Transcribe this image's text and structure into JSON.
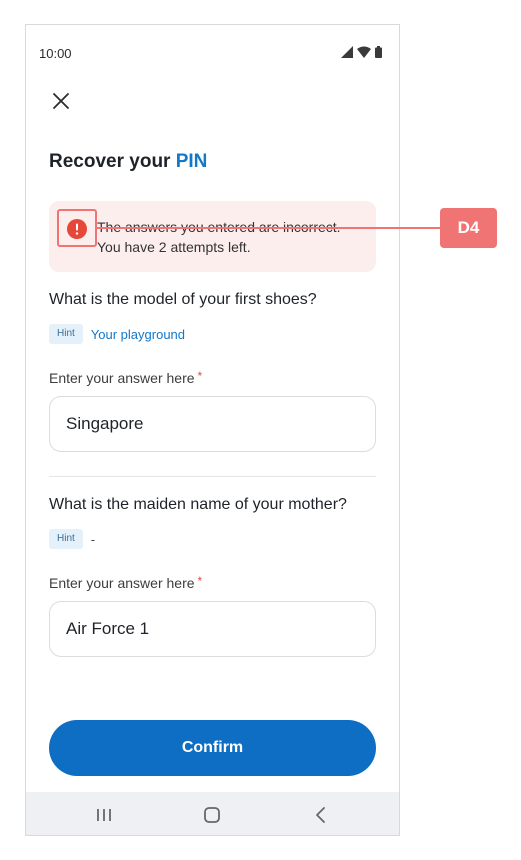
{
  "status_bar": {
    "time": "10:00"
  },
  "header": {
    "title_prefix": "Recover your",
    "title_accent": "PIN"
  },
  "alert": {
    "message_line1": "The answers you entered are incorrect.",
    "message_line2": "You have 2 attempts left.",
    "icon": "exclamation-circle-icon",
    "color": "#e5483a"
  },
  "questions": [
    {
      "question": "What is the model of your first shoes?",
      "hint_badge": "Hint",
      "hint_text": "Your playground",
      "field_label": "Enter your answer here",
      "required_mark": "*",
      "value": "Singapore"
    },
    {
      "question": "What is the maiden name of your mother?",
      "hint_badge": "Hint",
      "hint_text": "-",
      "field_label": "Enter your answer here",
      "required_mark": "*",
      "value": "Air Force 1"
    }
  ],
  "confirm": {
    "label": "Confirm"
  },
  "annotation": {
    "tag": "D4"
  },
  "colors": {
    "accent": "#1478c8",
    "button": "#0d6ec4",
    "annotation": "#f07474",
    "alert_bg": "#fdeeee"
  }
}
